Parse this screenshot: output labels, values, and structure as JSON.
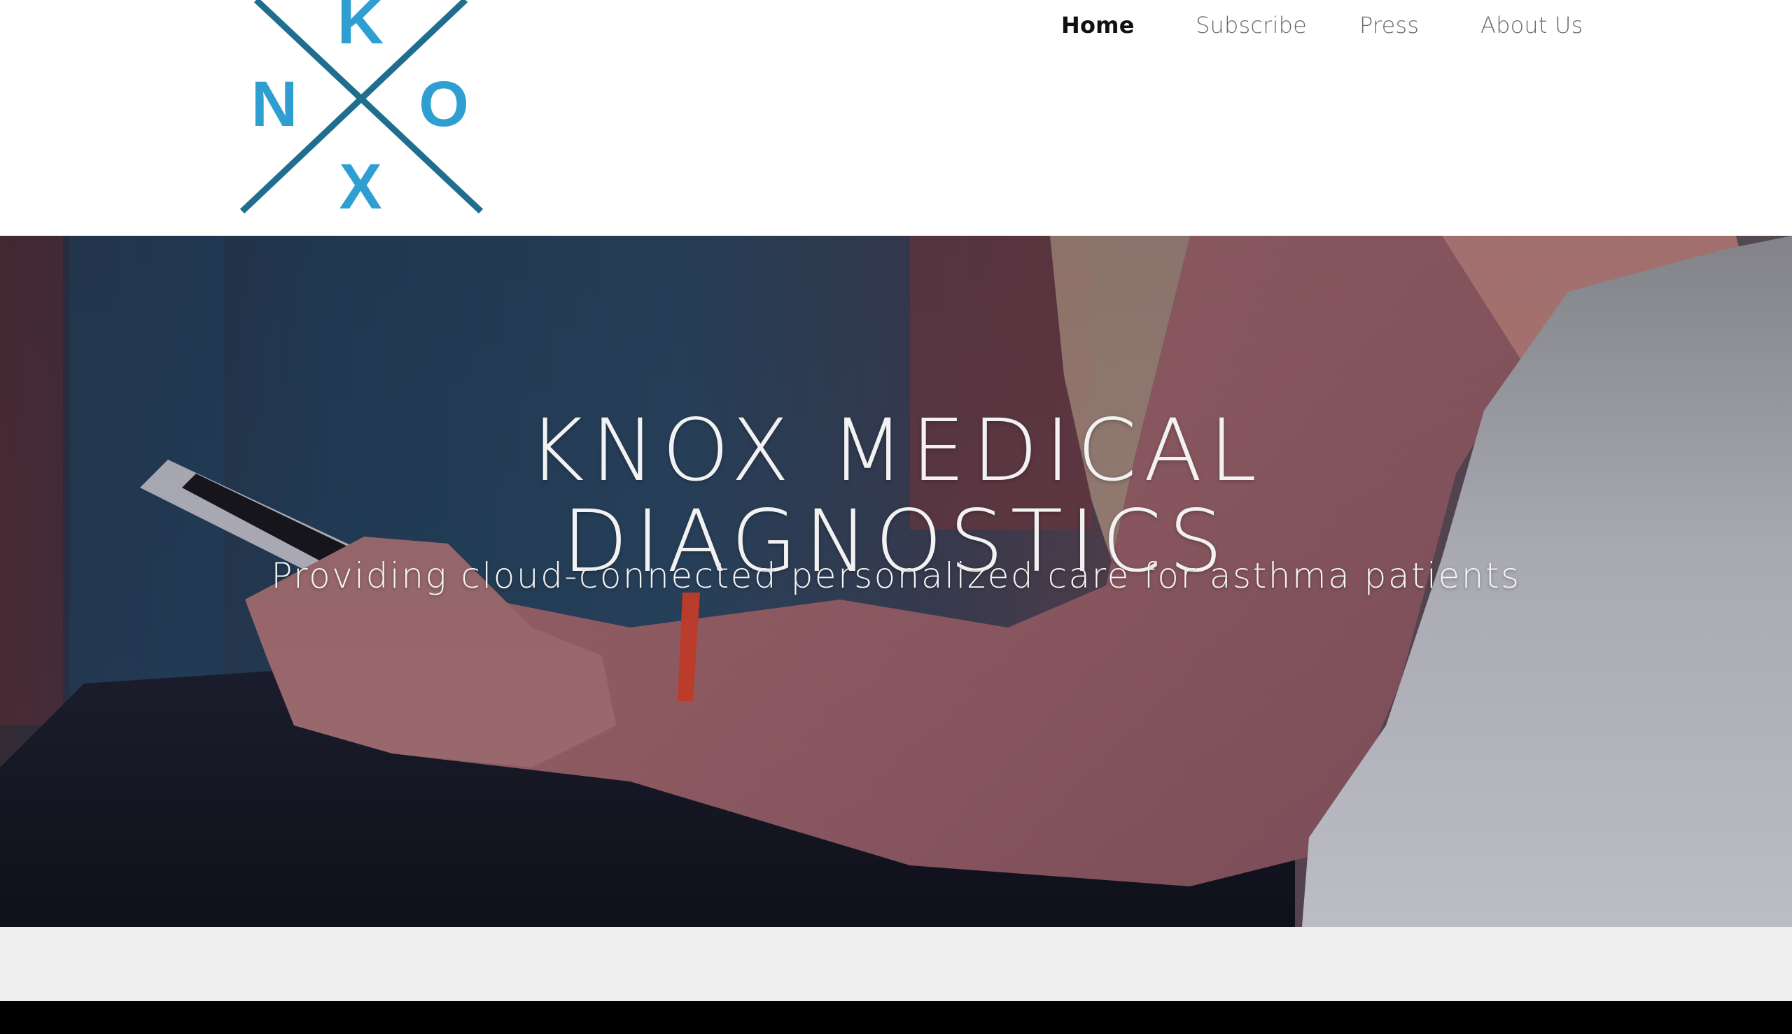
{
  "brand": {
    "logo_letters": {
      "top": "K",
      "left": "N",
      "right": "O",
      "bottom": "X"
    },
    "logo_letter_color": "#2f9fd2",
    "logo_line_color": "#1f6e8f"
  },
  "nav": {
    "items": [
      {
        "label": "Home",
        "active": true
      },
      {
        "label": "Subscribe",
        "active": false
      },
      {
        "label": "Press",
        "active": false
      },
      {
        "label": "About Us",
        "active": false
      }
    ]
  },
  "hero": {
    "title_line1": "KNOX MEDICAL",
    "title_line2": "DIAGNOSTICS",
    "subtitle": "Providing cloud-connected personalized care for asthma patients"
  },
  "colors": {
    "nav_active": "#111111",
    "nav_inactive": "#6a6a6a",
    "band": "#eeeeee",
    "footer": "#000000"
  }
}
